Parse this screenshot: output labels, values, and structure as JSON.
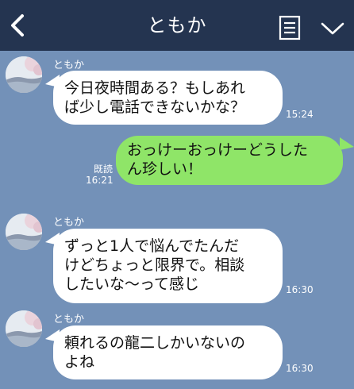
{
  "header": {
    "title": "ともか",
    "back_icon": "back-chevron-icon",
    "menu_icon": "notes-list-icon",
    "dropdown_icon": "chevron-down-icon",
    "background_color": "#243450"
  },
  "chat": {
    "background_color": "#7391b8",
    "incoming_bubble_color": "#ffffff",
    "outgoing_bubble_color": "#8fe568",
    "messages": [
      {
        "direction": "incoming",
        "sender": "ともか",
        "text": "今日夜時間ある？もしあれ\nば少し電話できないかな？",
        "time": "15:24"
      },
      {
        "direction": "outgoing",
        "read_label": "既読",
        "text": "おっけーおっけーどうした\nん珍しい！",
        "time": "16:21"
      },
      {
        "direction": "incoming",
        "sender": "ともか",
        "text": "ずっと1人で悩んでたんだ\nけどちょっと限界で。相談\nしたいな〜って感じ",
        "time": "16:30"
      },
      {
        "direction": "incoming",
        "sender": "ともか",
        "text": "頼れるの龍二しかいないの\nよね",
        "time": "16:30"
      }
    ]
  }
}
